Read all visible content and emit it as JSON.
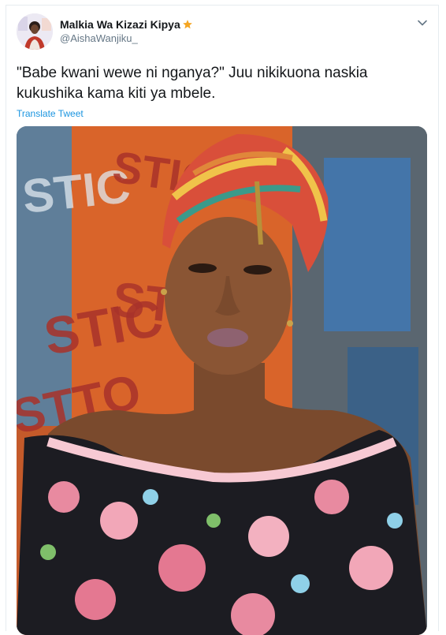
{
  "author": {
    "display_name": "Malkia Wa Kizazi Kipya",
    "handle": "@AishaWanjiku_",
    "badge_icon": "star-icon",
    "badge_color": "#f5a623"
  },
  "tweet": {
    "text": "\"Babe kwani wewe ni nganya?\" Juu nikikuona naskia kukushika kama kiti ya mbele.",
    "translate_label": "Translate Tweet"
  },
  "colors": {
    "accent": "#1b95e0",
    "secondary_text": "#657786",
    "border": "#e6ecf0"
  },
  "media": {
    "graffiti_text": [
      "STIC",
      "STIC",
      "STIC",
      "STTO",
      "STIC"
    ]
  }
}
